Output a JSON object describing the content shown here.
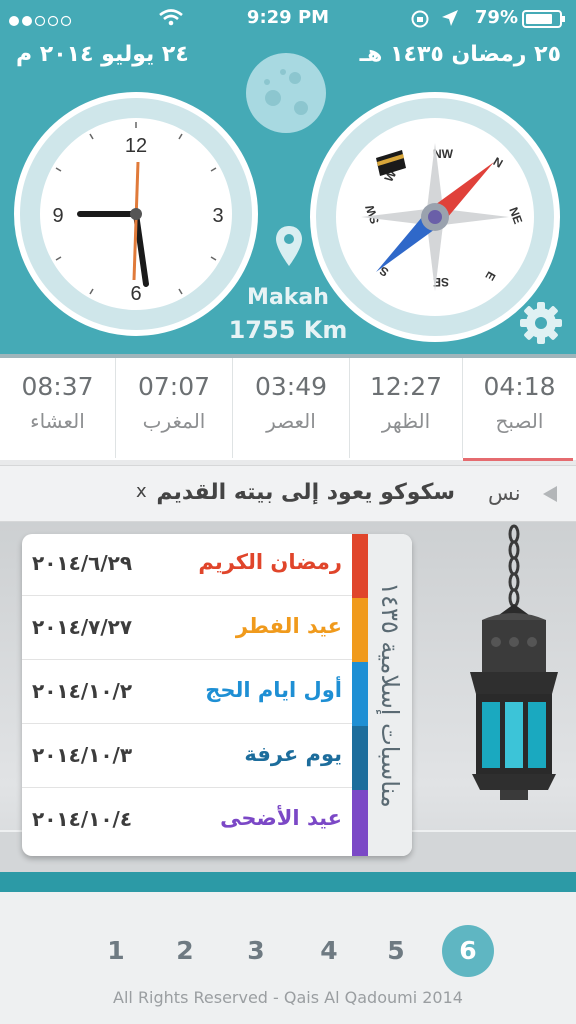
{
  "status_bar": {
    "time": "9:29 PM",
    "battery": "79%"
  },
  "dates": {
    "gregorian": "٢٤ يوليو ٢٠١٤ م",
    "hijri": "٢٥ رمضان ١٤٣٥ هـ"
  },
  "clock": {
    "hours": "12",
    "three": "3",
    "six": "6",
    "nine": "9"
  },
  "compass": {
    "n": "N",
    "ne": "NE",
    "e": "E",
    "se": "SE",
    "s": "S",
    "sw": "SW",
    "w": "W",
    "nw": "NW"
  },
  "location": {
    "city": "Makah",
    "distance": "1755 Km"
  },
  "prayers": [
    {
      "time": "08:37",
      "name": "العشاء"
    },
    {
      "time": "07:07",
      "name": "المغرب"
    },
    {
      "time": "03:49",
      "name": "العصر"
    },
    {
      "time": "12:27",
      "name": "الظهر"
    },
    {
      "time": "04:18",
      "name": "الصبح"
    }
  ],
  "ticker": {
    "source": "نس",
    "headline": "سكوكو يعود إلى بيته القديم",
    "close": "x"
  },
  "occasions_title": "مناسبات إسلامية ١٤٣٥",
  "occasions": [
    {
      "name": "رمضان الكريم",
      "date": "٢٠١٤/٦/٢٩",
      "color": "#e0452b"
    },
    {
      "name": "عيد الفطر",
      "date": "٢٠١٤/٧/٢٧",
      "color": "#f09a1c"
    },
    {
      "name": "أول ايام الحج",
      "date": "٢٠١٤/١٠/٢",
      "color": "#1e8fd4"
    },
    {
      "name": "يوم عرفة",
      "date": "٢٠١٤/١٠/٣",
      "color": "#1d6d9c"
    },
    {
      "name": "عيد الأضحى",
      "date": "٢٠١٤/١٠/٤",
      "color": "#7b48c6"
    }
  ],
  "pages": [
    "1",
    "2",
    "3",
    "4",
    "5",
    "6"
  ],
  "active_page": "6",
  "copyright": "All Rights Reserved - Qais Al Qadoumi 2014"
}
